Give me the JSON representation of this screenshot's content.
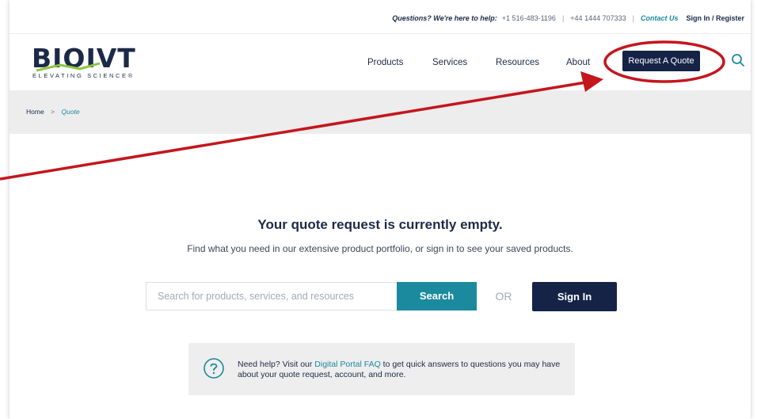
{
  "topbar": {
    "question": "Questions? We're here to help:",
    "phone_us": "+1 516-483-1196",
    "phone_uk": "+44 1444 707333",
    "divider": "|",
    "contact": "Contact Us",
    "sign_in": "Sign In / Register"
  },
  "logo": {
    "word": "BIOIVT",
    "tagline": "ELEVATING SCIENCE®"
  },
  "nav": {
    "items": [
      "Products",
      "Services",
      "Resources",
      "About"
    ],
    "quote_button": "Request A Quote",
    "search_icon": "search-icon"
  },
  "breadcrumb": {
    "home": "Home",
    "separator": ">",
    "current": "Quote"
  },
  "main": {
    "title": "Your quote request is currently empty.",
    "subtitle": "Find what you need in our extensive product portfolio, or sign in to see your saved products.",
    "search_placeholder": "Search for products, services, and resources",
    "search_value": "",
    "search_button": "Search",
    "or_label": "OR",
    "sign_in_button": "Sign In"
  },
  "help": {
    "icon": "question-circle-icon",
    "prefix": "Need help? Visit our ",
    "link": "Digital Portal FAQ",
    "suffix": " to get quick answers to questions you may have about your quote request, account, and more."
  },
  "colors": {
    "navy": "#152347",
    "teal": "#1b8a9e",
    "annotation_red": "#c4161c",
    "logo_green": "#8dc63f"
  }
}
